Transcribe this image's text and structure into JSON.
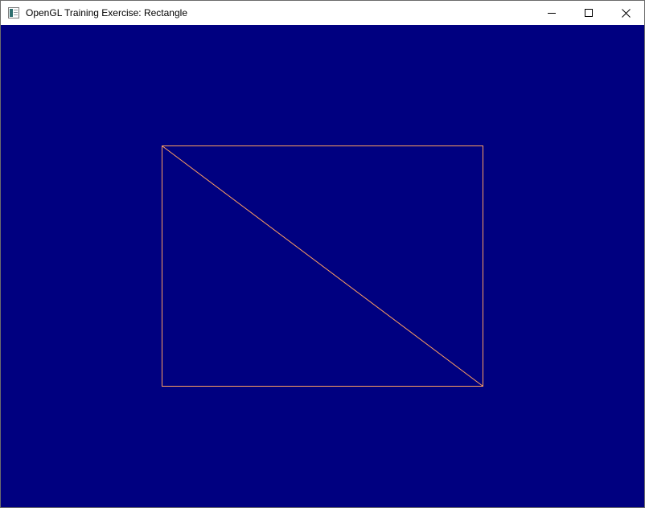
{
  "window": {
    "title": "OpenGL Training Exercise: Rectangle"
  },
  "caption_buttons": {
    "minimize": "minimize-icon",
    "maximize": "maximize-icon",
    "close": "close-icon"
  },
  "icons": {
    "app": "application-window-icon"
  },
  "colors": {
    "clear_color": "#000080",
    "line_color": "#ffa060"
  }
}
